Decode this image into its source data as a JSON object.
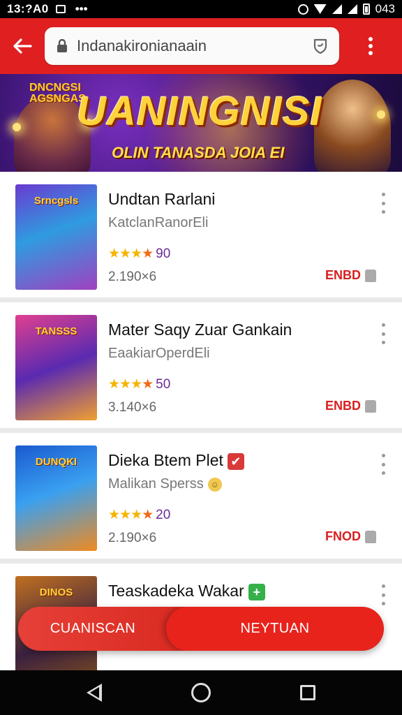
{
  "status_bar": {
    "time": "13:?A0",
    "extra": "•••",
    "battery": "043"
  },
  "toolbar": {
    "url": "Indanakironianaain"
  },
  "banner": {
    "logo_line1": "DNCNGSI",
    "logo_line2": "AGSNGAS",
    "title": "UANINGNISI",
    "subtitle": "OLIN TANASDA JOIA EI"
  },
  "apps": [
    {
      "name": "Undtan Rarlani",
      "developer": "KatclanRanorEli",
      "stars": "★★★",
      "last_star": "★",
      "score": "90",
      "size": "2.190×6",
      "action": "ENBD",
      "thumb_label": "Srncgsls",
      "name_badge": "",
      "dev_badge": ""
    },
    {
      "name": "Mater Saqy Zuar Gankain",
      "developer": "EaakiarOperdEli",
      "stars": "★★★",
      "last_star": "★",
      "score": "50",
      "size": "3.140×6",
      "action": "ENBD",
      "thumb_label": "TANSSS",
      "name_badge": "",
      "dev_badge": ""
    },
    {
      "name": "Dieka Btem Plet",
      "developer": "Malikan Sperss",
      "stars": "★★★",
      "last_star": "★",
      "score": "20",
      "size": "2.190×6",
      "action": "FNOD",
      "thumb_label": "DUNQKI",
      "name_badge": "✔",
      "dev_badge": "☺"
    },
    {
      "name": "Teaskadeka Wakar",
      "developer": "",
      "stars": "★★★",
      "last_star": "★",
      "score": "",
      "size": "",
      "action": "",
      "thumb_label": "DINOS",
      "name_badge": "+",
      "dev_badge": ""
    }
  ],
  "float_bar": {
    "left_label": "CUANISCAN",
    "right_label": "NEYTUAN"
  },
  "colors": {
    "accent": "#e02020",
    "star": "#f5b400",
    "score": "#6a2a9a"
  }
}
